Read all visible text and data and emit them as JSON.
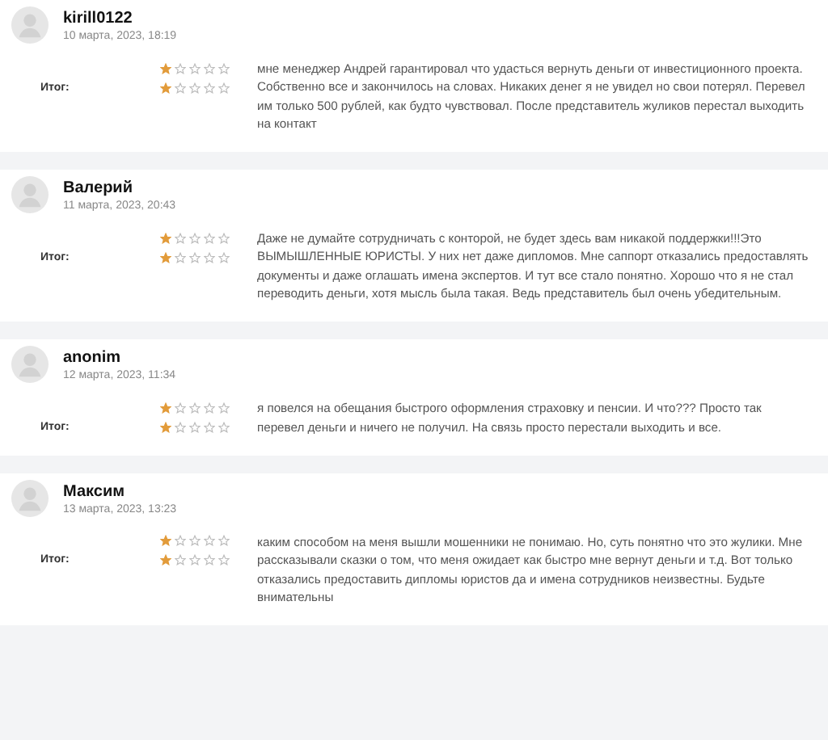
{
  "reviews": [
    {
      "author": "kirill0122",
      "date": "10 марта, 2023, 18:19",
      "ratings": [
        {
          "stars": 1
        },
        {
          "label": "Итог:",
          "stars": 1
        }
      ],
      "text": "мне менеджер Андрей гарантировал что удасться вернуть деньги от инвестиционного проекта. Собственно все и закончилось на словах. Никаких денег я не увидел но свои потерял. Перевел им только 500 рублей, как будто чувствовал. После представитель жуликов перестал выходить на контакт"
    },
    {
      "author": "Валерий",
      "date": "11 марта, 2023, 20:43",
      "ratings": [
        {
          "stars": 1
        },
        {
          "label": "Итог:",
          "stars": 1
        }
      ],
      "text": "Даже не думайте сотрудничать с конторой, не будет здесь вам никакой поддержки!!!Это ВЫМЫШЛЕННЫЕ ЮРИСТЫ. У них нет даже дипломов. Мне саппорт отказались предоставлять документы и даже оглашать имена экспертов. И тут все стало понятно. Хорошо что я не стал переводить деньги, хотя мысль была такая. Ведь представитель был очень убедительным."
    },
    {
      "author": "anonim",
      "date": "12 марта, 2023, 11:34",
      "ratings": [
        {
          "stars": 1
        },
        {
          "label": "Итог:",
          "stars": 1
        }
      ],
      "text": "я повелся на обещания быстрого оформления страховку и пенсии. И что??? Просто так перевел деньги и ничего не получил. На связь просто перестали выходить и все."
    },
    {
      "author": "Максим",
      "date": "13 марта, 2023, 13:23",
      "ratings": [
        {
          "stars": 1
        },
        {
          "label": "Итог:",
          "stars": 1
        }
      ],
      "text": "каким способом на меня вышли мошенники не понимаю. Но, суть понятно что это жулики. Мне рассказывали сказки о том, что меня ожидает как быстро мне вернут деньги и т.д. Вот только отказались предоставить дипломы юристов да и имена сотрудников неизвестны. Будьте внимательны"
    }
  ]
}
